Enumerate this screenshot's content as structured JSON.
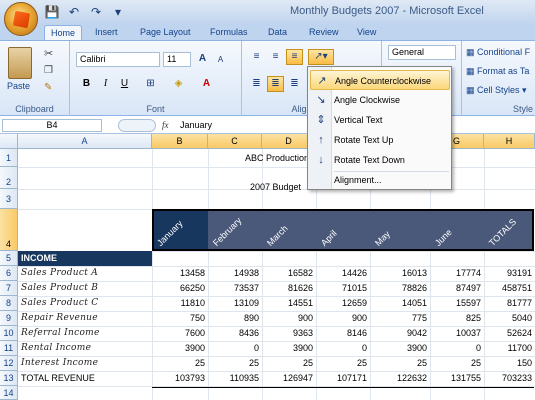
{
  "window": {
    "title": "Monthly Budgets 2007 - Microsoft Excel"
  },
  "qat": {
    "save_icon": "💾",
    "undo_icon": "↶",
    "redo_icon": "↷",
    "more_icon": "▾"
  },
  "tabs": [
    "Home",
    "Insert",
    "Page Layout",
    "Formulas",
    "Data",
    "Review",
    "View"
  ],
  "ribbon": {
    "clipboard": {
      "paste": "Paste",
      "label": "Clipboard"
    },
    "font": {
      "name": "Calibri",
      "size": "11",
      "label": "Font",
      "bold": "B",
      "italic": "I",
      "underline": "U",
      "grow": "A",
      "shrink": "A"
    },
    "alignment": {
      "label": "Alignment"
    },
    "number": {
      "format": "General"
    },
    "styles": {
      "conditional": "Conditional F",
      "format_table": "Format as Ta",
      "cell_styles": "Cell Styles",
      "label": "Style"
    }
  },
  "formula_bar": {
    "name_box": "B4",
    "fx": "fx",
    "content": "January"
  },
  "columns": [
    "A",
    "B",
    "C",
    "D",
    "E",
    "F",
    "G",
    "H"
  ],
  "rows": [
    "1",
    "2",
    "3",
    "4",
    "5",
    "6",
    "7",
    "8",
    "9",
    "10",
    "11",
    "12",
    "13",
    "14"
  ],
  "sheet": {
    "title": "ABC Production Con",
    "subtitle": "2007 Budget",
    "headers": [
      "January",
      "February",
      "March",
      "April",
      "May",
      "June",
      "TOTALS"
    ],
    "income_label": "INCOME",
    "income_rows": [
      {
        "label": "Sales Product A",
        "values": [
          "13458",
          "14938",
          "16582",
          "14426",
          "16013",
          "17774",
          "93191"
        ]
      },
      {
        "label": "Sales Product B",
        "values": [
          "66250",
          "73537",
          "81626",
          "71015",
          "78826",
          "87497",
          "458751"
        ]
      },
      {
        "label": "Sales Product C",
        "values": [
          "11810",
          "13109",
          "14551",
          "12659",
          "14051",
          "15597",
          "81777"
        ]
      },
      {
        "label": "Repair Revenue",
        "values": [
          "750",
          "890",
          "900",
          "900",
          "775",
          "825",
          "5040"
        ]
      },
      {
        "label": "Referral Income",
        "values": [
          "7600",
          "8436",
          "9363",
          "8146",
          "9042",
          "10037",
          "52624"
        ]
      },
      {
        "label": "Rental Income",
        "values": [
          "3900",
          "0",
          "3900",
          "0",
          "3900",
          "0",
          "11700"
        ]
      },
      {
        "label": "Interest Income",
        "values": [
          "25",
          "25",
          "25",
          "25",
          "25",
          "25",
          "150"
        ]
      }
    ],
    "total_row": {
      "label": "TOTAL REVENUE",
      "values": [
        "103793",
        "110935",
        "126947",
        "107171",
        "122632",
        "131755",
        "703233"
      ]
    }
  },
  "orientation_menu": {
    "items": [
      {
        "label": "Angle Counterclockwise",
        "icon": "angle-ccw",
        "glyph": "↗"
      },
      {
        "label": "Angle Clockwise",
        "icon": "angle-cw",
        "glyph": "↘"
      },
      {
        "label": "Vertical Text",
        "icon": "vertical-text",
        "glyph": "⇕"
      },
      {
        "label": "Rotate Text Up",
        "icon": "rotate-up",
        "glyph": "↑"
      },
      {
        "label": "Rotate Text Down",
        "icon": "rotate-down",
        "glyph": "↓"
      },
      {
        "label": "Alignment...",
        "icon": "",
        "glyph": ""
      }
    ]
  },
  "colors": {
    "header_band": "#4a5879",
    "income_band": "#17375e",
    "accent": "#f9c966"
  }
}
